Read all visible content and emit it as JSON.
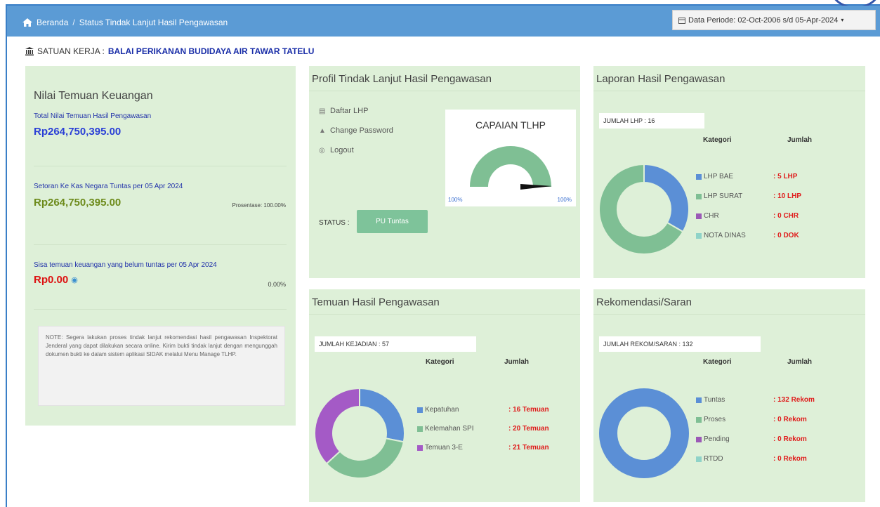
{
  "breadcrumb": {
    "home": "Beranda",
    "current": "Status Tindak Lanjut Hasil Pengawasan"
  },
  "period": {
    "label": "Data Periode: 02-Oct-2006 s/d 05-Apr-2024"
  },
  "satker": {
    "prefix": "SATUAN KERJA :",
    "name": "BALAI PERIKANAN BUDIDAYA AIR TAWAR TATELU"
  },
  "left": {
    "title": "Nilai Temuan Keuangan",
    "total_label": "Total Nilai Temuan Hasil Pengawasan",
    "total_value": "Rp264,750,395.00",
    "setoran_label": "Setoran Ke Kas Negara Tuntas per 05 Apr 2024",
    "setoran_value": "Rp264,750,395.00",
    "setoran_pct": "Prosentase: 100.00%",
    "sisa_label": "Sisa temuan keuangan yang belum tuntas per 05 Apr 2024",
    "sisa_value": "Rp0.00",
    "sisa_pct": "0.00%",
    "note": "NOTE: Segera lakukan proses tindak lanjut rekomendasi hasil pengawasan Inspektorat Jenderal yang dapat dilakukan secara online. Kirim bukti tindak lanjut dengan mengunggah dokumen bukti ke dalam sistem aplikasi SIDAK melalui Menu Manage TLHP."
  },
  "profil": {
    "title": "Profil Tindak Lanjut Hasil Pengawasan",
    "menu": [
      "Daftar LHP",
      "Change Password",
      "Logout"
    ],
    "gauge_title": "CAPAIAN TLHP",
    "gauge_min": "100%",
    "gauge_max": "100%",
    "gauge_value": 100,
    "status_label": "STATUS :",
    "status_value": "PU Tuntas"
  },
  "lhp": {
    "title": "Laporan Hasil Pengawasan",
    "count": "JUMLAH LHP : 16",
    "col_kategori": "Kategori",
    "col_jumlah": "Jumlah",
    "items": [
      {
        "label": "LHP BAE",
        "value": ": 5 LHP",
        "count": 5,
        "color": "#5b8fd6"
      },
      {
        "label": "LHP SURAT",
        "value": ": 10 LHP",
        "count": 10,
        "color": "#7fbf94"
      },
      {
        "label": "CHR",
        "value": ": 0 CHR",
        "count": 0,
        "color": "#9b59b6"
      },
      {
        "label": "NOTA DINAS",
        "value": ": 0 DOK",
        "count": 0,
        "color": "#8fd3c8"
      }
    ]
  },
  "temuan": {
    "title": "Temuan Hasil Pengawasan",
    "count": "JUMLAH KEJADIAN : 57",
    "col_kategori": "Kategori",
    "col_jumlah": "Jumlah",
    "items": [
      {
        "label": "Kepatuhan",
        "value": ": 16 Temuan",
        "count": 16,
        "color": "#5b8fd6"
      },
      {
        "label": "Kelemahan SPI",
        "value": ": 20 Temuan",
        "count": 20,
        "color": "#7fbf94"
      },
      {
        "label": "Temuan 3-E",
        "value": ": 21 Temuan",
        "count": 21,
        "color": "#a45ac6"
      }
    ]
  },
  "rekom": {
    "title": "Rekomendasi/Saran",
    "count": "JUMLAH REKOM/SARAN : 132",
    "col_kategori": "Kategori",
    "col_jumlah": "Jumlah",
    "items": [
      {
        "label": "Tuntas",
        "value": ": 132 Rekom",
        "count": 132,
        "color": "#5b8fd6"
      },
      {
        "label": "Proses",
        "value": ": 0 Rekom",
        "count": 0,
        "color": "#7fbf94"
      },
      {
        "label": "Pending",
        "value": ": 0 Rekom",
        "count": 0,
        "color": "#9b59b6"
      },
      {
        "label": "RTDD",
        "value": ": 0 Rekom",
        "count": 0,
        "color": "#8fd3c8"
      }
    ]
  }
}
